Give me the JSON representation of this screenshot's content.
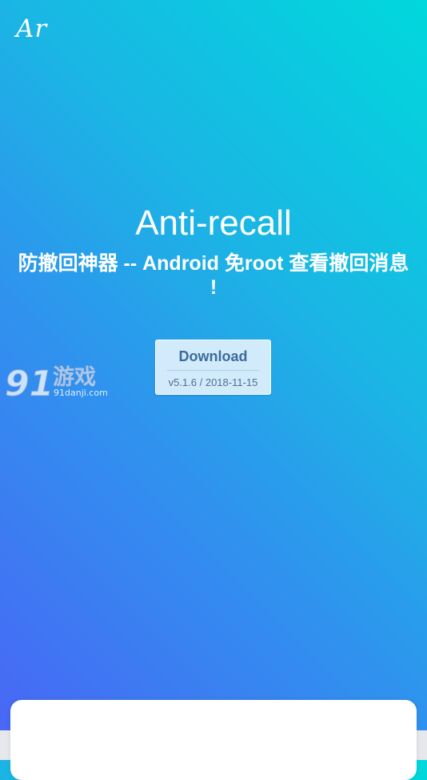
{
  "header": {
    "logo_text": "Ar"
  },
  "hero": {
    "title": "Anti-recall",
    "subtitle": "防撤回神器 -- Android 免root 查看撤回消息 !"
  },
  "download": {
    "label": "Download",
    "version": "v5.1.6 / 2018-11-15"
  },
  "watermark": {
    "number": "91",
    "brand": "游戏",
    "domain": "91danji.com"
  },
  "colors": {
    "gradient_top_right": "#00d8dc",
    "gradient_bottom_left": "#4a64f6",
    "button_bg": "#e1f1fc",
    "button_text": "#3d6b9c"
  }
}
